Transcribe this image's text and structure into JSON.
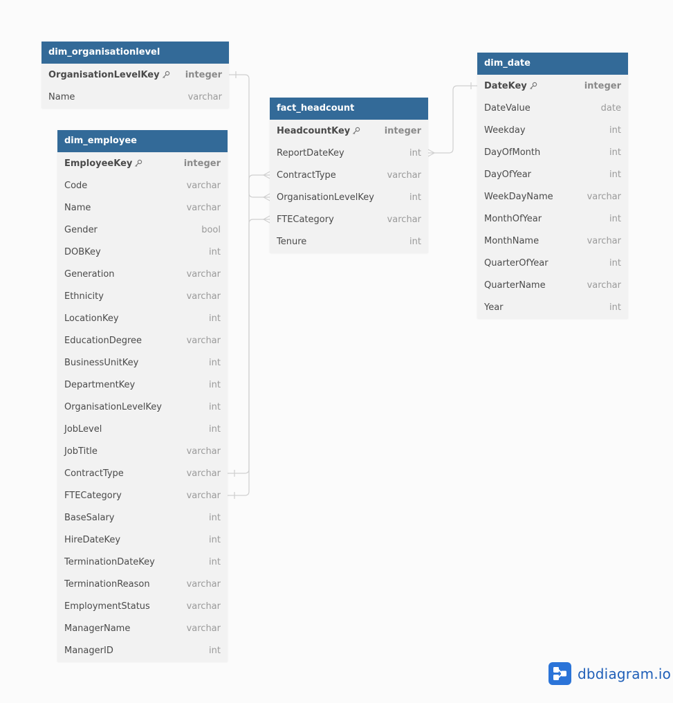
{
  "tables": [
    {
      "id": "dim_organisationlevel",
      "name": "dim_organisationlevel",
      "fields": [
        {
          "name": "OrganisationLevelKey",
          "type": "integer",
          "pk": true
        },
        {
          "name": "Name",
          "type": "varchar"
        }
      ]
    },
    {
      "id": "dim_employee",
      "name": "dim_employee",
      "fields": [
        {
          "name": "EmployeeKey",
          "type": "integer",
          "pk": true
        },
        {
          "name": "Code",
          "type": "varchar"
        },
        {
          "name": "Name",
          "type": "varchar"
        },
        {
          "name": "Gender",
          "type": "bool"
        },
        {
          "name": "DOBKey",
          "type": "int"
        },
        {
          "name": "Generation",
          "type": "varchar"
        },
        {
          "name": "Ethnicity",
          "type": "varchar"
        },
        {
          "name": "LocationKey",
          "type": "int"
        },
        {
          "name": "EducationDegree",
          "type": "varchar"
        },
        {
          "name": "BusinessUnitKey",
          "type": "int"
        },
        {
          "name": "DepartmentKey",
          "type": "int"
        },
        {
          "name": "OrganisationLevelKey",
          "type": "int"
        },
        {
          "name": "JobLevel",
          "type": "int"
        },
        {
          "name": "JobTitle",
          "type": "varchar"
        },
        {
          "name": "ContractType",
          "type": "varchar"
        },
        {
          "name": "FTECategory",
          "type": "varchar"
        },
        {
          "name": "BaseSalary",
          "type": "int"
        },
        {
          "name": "HireDateKey",
          "type": "int"
        },
        {
          "name": "TerminationDateKey",
          "type": "int"
        },
        {
          "name": "TerminationReason",
          "type": "varchar"
        },
        {
          "name": "EmploymentStatus",
          "type": "varchar"
        },
        {
          "name": "ManagerName",
          "type": "varchar"
        },
        {
          "name": "ManagerID",
          "type": "int"
        }
      ]
    },
    {
      "id": "fact_headcount",
      "name": "fact_headcount",
      "fields": [
        {
          "name": "HeadcountKey",
          "type": "integer",
          "pk": true
        },
        {
          "name": "ReportDateKey",
          "type": "int"
        },
        {
          "name": "ContractType",
          "type": "varchar"
        },
        {
          "name": "OrganisationLevelKey",
          "type": "int"
        },
        {
          "name": "FTECategory",
          "type": "varchar"
        },
        {
          "name": "Tenure",
          "type": "int"
        }
      ]
    },
    {
      "id": "dim_date",
      "name": "dim_date",
      "fields": [
        {
          "name": "DateKey",
          "type": "integer",
          "pk": true
        },
        {
          "name": "DateValue",
          "type": "date"
        },
        {
          "name": "Weekday",
          "type": "int"
        },
        {
          "name": "DayOfMonth",
          "type": "int"
        },
        {
          "name": "DayOfYear",
          "type": "int"
        },
        {
          "name": "WeekDayName",
          "type": "varchar"
        },
        {
          "name": "MonthOfYear",
          "type": "int"
        },
        {
          "name": "MonthName",
          "type": "varchar"
        },
        {
          "name": "QuarterOfYear",
          "type": "int"
        },
        {
          "name": "QuarterName",
          "type": "varchar"
        },
        {
          "name": "Year",
          "type": "int"
        }
      ]
    }
  ],
  "relationships": [
    {
      "from": "dim_organisationlevel.OrganisationLevelKey",
      "to": "fact_headcount.OrganisationLevelKey",
      "type": "one-to-many"
    },
    {
      "from": "dim_employee.ContractType",
      "to": "fact_headcount.ContractType",
      "type": "one-to-many"
    },
    {
      "from": "dim_employee.FTECategory",
      "to": "fact_headcount.FTECategory",
      "type": "one-to-many"
    },
    {
      "from": "dim_date.DateKey",
      "to": "fact_headcount.ReportDateKey",
      "type": "one-to-many"
    }
  ],
  "brand": {
    "name": "dbdiagram.io",
    "logo_icon": "share-nodes-icon"
  },
  "colors": {
    "header": "#336a98",
    "body": "#f2f2f2",
    "line": "#cfcfcf",
    "brand": "#2b74d8"
  }
}
